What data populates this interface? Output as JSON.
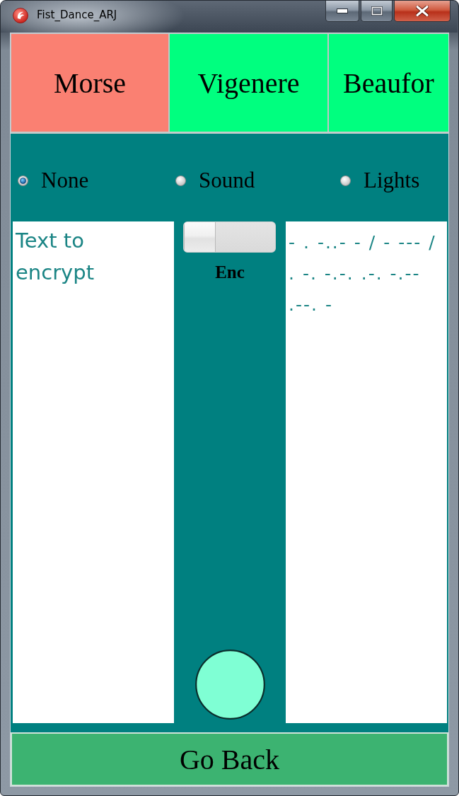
{
  "window": {
    "title": "Fist_Dance_ARJ"
  },
  "tabs": [
    {
      "label": "Morse",
      "selected": true
    },
    {
      "label": "Vigenere",
      "selected": false
    },
    {
      "label": "Beaufor",
      "selected": false
    }
  ],
  "output_modes": [
    {
      "label": "None",
      "selected": true
    },
    {
      "label": "Sound",
      "selected": false
    },
    {
      "label": "Lights",
      "selected": false
    }
  ],
  "input": {
    "value": "Text to encrypt"
  },
  "toggle": {
    "label": "Enc",
    "on": false
  },
  "output": {
    "value": "- . -..- - / - --- / . -. -.-. .-. -.-- .--. -"
  },
  "buttons": [
    {
      "label": "Go Back"
    }
  ]
}
